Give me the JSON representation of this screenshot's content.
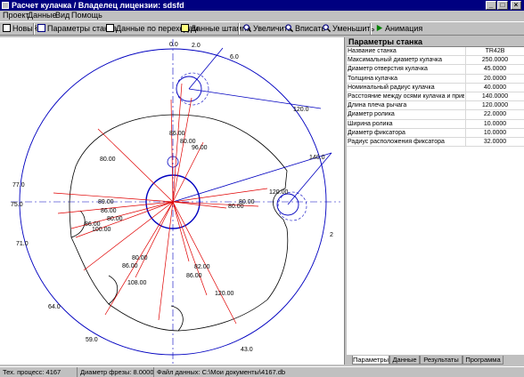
{
  "window": {
    "title": "Расчет кулачка / Владелец лицензии: sdsfd",
    "minimize": "_",
    "maximize": "□",
    "close": "×"
  },
  "menu": [
    "Проект",
    "Данные",
    "Вид",
    "Помощь"
  ],
  "toolbar": {
    "new": "Новый",
    "machine_params": "Параметры станка",
    "transition_data": "Данные по переходам",
    "stamp_data": "Данные штампа",
    "zoom_in": "Увеличить",
    "fit": "Вписать",
    "zoom_out": "Уменьшить",
    "animation": "Анимация"
  },
  "panel": {
    "title": "Параметры станка",
    "rows": [
      {
        "name": "Название станка",
        "value": "TR42B"
      },
      {
        "name": "Максимальный диаметр кулачка",
        "value": "250.0000"
      },
      {
        "name": "Диаметр отверстия кулачка",
        "value": "45.0000"
      },
      {
        "name": "Толщина кулачка",
        "value": "20.0000"
      },
      {
        "name": "Номинальный радиус кулачка",
        "value": "40.0000"
      },
      {
        "name": "Расстояние между осями кулачка и приво...",
        "value": "140.0000"
      },
      {
        "name": "Длина плеча рычага",
        "value": "120.0000"
      },
      {
        "name": "Диаметр ролика",
        "value": "22.0000"
      },
      {
        "name": "Ширина ролика",
        "value": "10.0000"
      },
      {
        "name": "Диаметр фиксатора",
        "value": "10.0000"
      },
      {
        "name": "Радиус расположения фиксатора",
        "value": "32.0000"
      }
    ]
  },
  "tabs": [
    "Параметры",
    "Данные",
    "Результаты",
    "Программа"
  ],
  "status": {
    "process": "Тех. процесс: 4167",
    "cutter": "Диаметр фрезы: 8.0000",
    "file": "Файл данных: C:\\Мои документы\\4167.db"
  },
  "drawing": {
    "angle_labels": {
      "a0": "0.0",
      "a2": "2.0",
      "a6": "6.0",
      "a120": "120.0",
      "a140": "140.0",
      "a2b": "2",
      "a77": "77.0",
      "a75": "75.0",
      "a71": "71.0",
      "a64": "64.0",
      "a59": "59.0",
      "a43": "43.0"
    },
    "dim_labels": {
      "d86a": "86.00",
      "d80a": "80.00",
      "d96": "96.00",
      "d80b": "80.00",
      "d120r": "120.00",
      "d80r": "80.00",
      "d89": "89.00",
      "d86b": "86.00",
      "d80c": "80.00",
      "d86c": "86.00",
      "d100": "100.00",
      "d80d": "80.00",
      "d86d": "86.00",
      "d108": "108.00",
      "d82": "82.00",
      "d86e": "86.00",
      "d120b": "120.00",
      "d80e": "80.00"
    }
  }
}
